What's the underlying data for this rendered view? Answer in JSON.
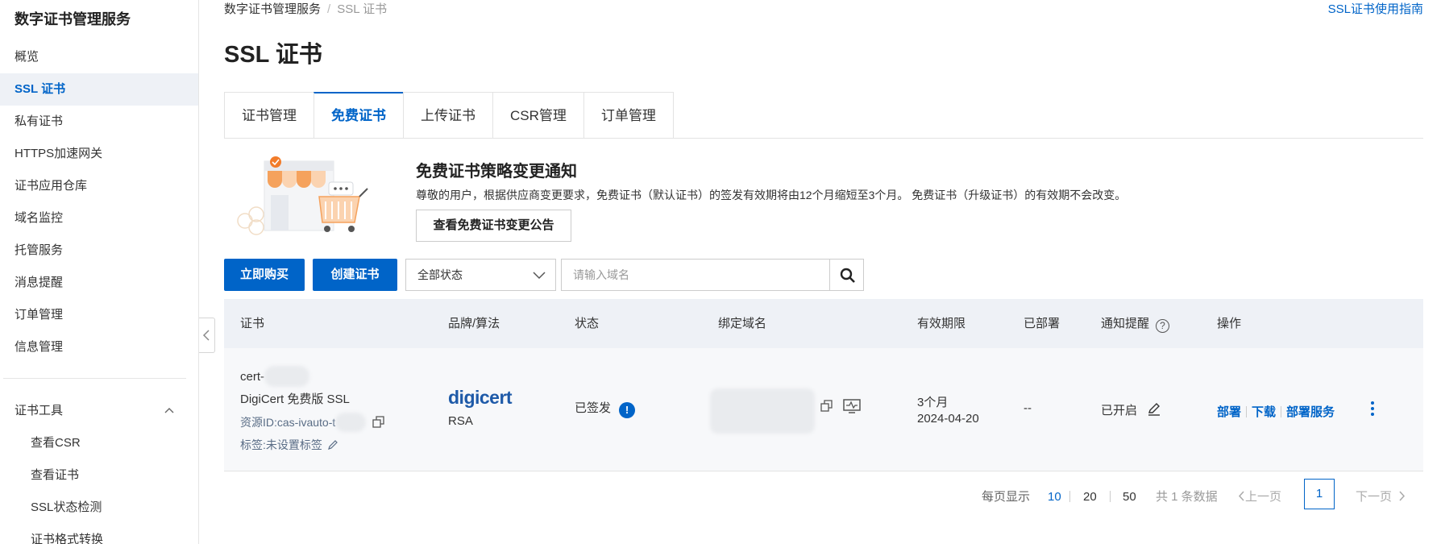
{
  "sidebar": {
    "title": "数字证书管理服务",
    "items": [
      {
        "label": "概览"
      },
      {
        "label": "SSL 证书"
      },
      {
        "label": "私有证书"
      },
      {
        "label": "HTTPS加速网关"
      },
      {
        "label": "证书应用仓库"
      },
      {
        "label": "域名监控"
      },
      {
        "label": "托管服务"
      },
      {
        "label": "消息提醒"
      },
      {
        "label": "订单管理"
      },
      {
        "label": "信息管理"
      }
    ],
    "tools_group": "证书工具",
    "tools": [
      {
        "label": "查看CSR"
      },
      {
        "label": "查看证书"
      },
      {
        "label": "SSL状态检测"
      },
      {
        "label": "证书格式转换"
      }
    ]
  },
  "header": {
    "breadcrumb_root": "数字证书管理服务",
    "breadcrumb_sep": "/",
    "breadcrumb_current": "SSL 证书",
    "guide_link": "SSL证书使用指南",
    "title": "SSL 证书"
  },
  "tabs": [
    {
      "label": "证书管理"
    },
    {
      "label": "免费证书"
    },
    {
      "label": "上传证书"
    },
    {
      "label": "CSR管理"
    },
    {
      "label": "订单管理"
    }
  ],
  "notice": {
    "title": "免费证书策略变更通知",
    "text": "尊敬的用户，根据供应商变更要求，免费证书（默认证书）的签发有效期将由12个月缩短至3个月。 免费证书（升级证书）的有效期不会改变。",
    "button": "查看免费证书变更公告"
  },
  "toolbar": {
    "buy": "立即购买",
    "create": "创建证书",
    "status_select": "全部状态",
    "search_placeholder": "请输入域名"
  },
  "table": {
    "headers": {
      "cert": "证书",
      "brand": "品牌/算法",
      "status": "状态",
      "domain": "绑定域名",
      "validity": "有效期限",
      "deployed": "已部署",
      "notify": "通知提醒",
      "help_glyph": "?",
      "actions": "操作"
    },
    "rows": [
      {
        "cert_name": "cert-",
        "cert_type": "DigiCert 免费版 SSL",
        "resource_id": "资源ID:cas-ivauto-t",
        "tag": "标签:未设置标签",
        "brand_logo": "digicert",
        "algorithm": "RSA",
        "status": "已签发",
        "status_glyph": "!",
        "validity_period": "3个月",
        "expiry_date": "2024-04-20",
        "deployed": "--",
        "notify": "已开启",
        "actions": {
          "deploy": "部署",
          "download": "下载",
          "deploy_service": "部署服务"
        }
      }
    ]
  },
  "pagination": {
    "per_page_label": "每页显示",
    "sizes": [
      "10",
      "20",
      "50"
    ],
    "total": "共 1 条数据",
    "prev": "上一页",
    "current": "1",
    "next": "下一页"
  },
  "colors": {
    "primary": "#0064c8",
    "header_bg": "#eef1f6",
    "row_bg": "#f7f8fa"
  }
}
